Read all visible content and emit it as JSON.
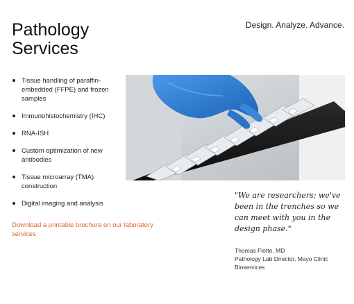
{
  "header": {
    "title_line1": "Pathology",
    "title_line2": "Services",
    "tagline": "Design. Analyze. Advance."
  },
  "services": {
    "items": [
      {
        "label": "Tissue handling of paraffin-embedded (FFPE) and frozen samples"
      },
      {
        "label": "Immunohistochemistry (IHC)"
      },
      {
        "label": "RNA-ISH"
      },
      {
        "label": "Custom optimization of new antibodies"
      },
      {
        "label": "Tissue microarray (TMA) construction"
      },
      {
        "label": "Digital imaging and analysis"
      }
    ]
  },
  "brochure": {
    "link_text": "Download a printable brochure on our laboratory services"
  },
  "quote": {
    "text": "\"We are researchers; we've been in the trenches so we can meet with you in the design phase.\"",
    "author_name": "Thomas Flotte, MD",
    "author_title": "Pathology Lab Director, Mayo Clinic",
    "author_org": "Bioservices"
  },
  "colors": {
    "link": "#e0622a",
    "glove": "#2f7fd6"
  }
}
